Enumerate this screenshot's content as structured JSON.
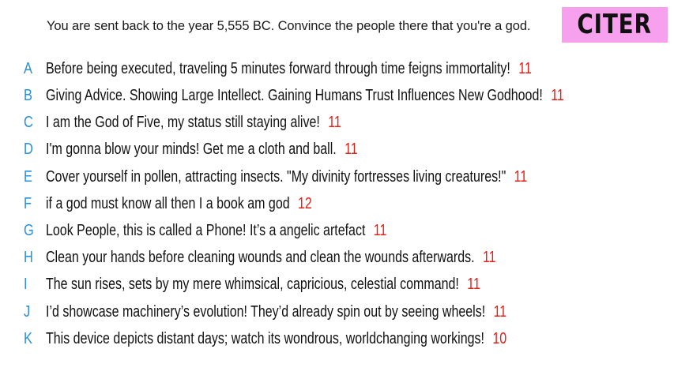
{
  "prompt": "You are sent back to the year 5,555 BC. Convince the people there that you're a god.",
  "player": {
    "name": "CITER",
    "badge_color": "#f7a0ee"
  },
  "colors": {
    "letter": "#2b8fd8",
    "score": "#e0201a",
    "text": "#111111"
  },
  "answers": [
    {
      "letter": "A",
      "text": "Before being executed, traveling 5 minutes forward through time feigns immortality!",
      "score": "11"
    },
    {
      "letter": "B",
      "text": "Giving Advice. Showing Large Intellect. Gaining Humans Trust Influences New Godhood!",
      "score": "11"
    },
    {
      "letter": "C",
      "text": "I am the God of Five, my status still staying alive!",
      "score": "11"
    },
    {
      "letter": "D",
      "text": "I'm gonna blow your minds! Get me a cloth and ball.",
      "score": "11"
    },
    {
      "letter": "E",
      "text": "Cover yourself in pollen, attracting insects. \"My divinity fortresses living creatures!\"",
      "score": "11"
    },
    {
      "letter": "F",
      "text": "if a god must know all then I a book am god",
      "score": "12"
    },
    {
      "letter": "G",
      "text": "Look People, this is called a Phone! It’s a angelic artefact",
      "score": "11"
    },
    {
      "letter": "H",
      "text": "Clean your hands before cleaning wounds and clean the wounds afterwards.",
      "score": "11"
    },
    {
      "letter": "I",
      "text": "The sun rises, sets by my mere whimsical, capricious, celestial command!",
      "score": "11"
    },
    {
      "letter": "J",
      "text": "I’d showcase machinery’s evolution! They’d already spin out by seeing wheels!",
      "score": "11"
    },
    {
      "letter": "K",
      "text": "This device depicts distant days; watch its wondrous, worldchanging workings!",
      "score": "10"
    }
  ]
}
